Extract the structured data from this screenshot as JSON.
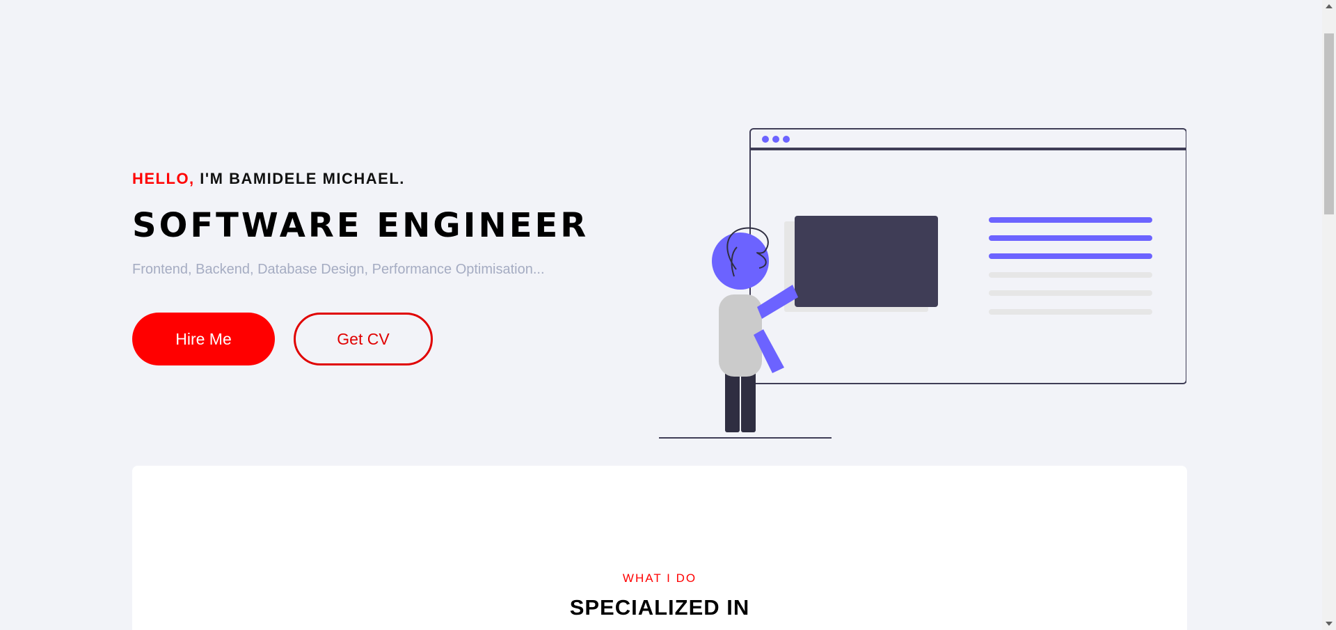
{
  "hero": {
    "hello": "HELLO,",
    "name": " I'M BAMIDELE MICHAEL.",
    "role": "SOFTWARE ENGINEER",
    "skills": "Frontend, Backend, Database Design, Performance Optimisation...",
    "hire_label": "Hire Me",
    "cv_label": "Get CV"
  },
  "services": {
    "eyebrow": "WHAT I DO",
    "heading": "SPECIALIZED IN"
  },
  "colors": {
    "accent": "#ff0000",
    "illustration_primary": "#6c63ff",
    "illustration_dark": "#3f3d56",
    "background": "#f2f3f8"
  }
}
